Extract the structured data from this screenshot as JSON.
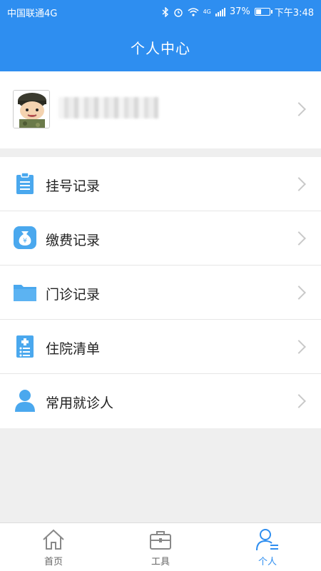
{
  "status": {
    "carrier": "中国联通4G",
    "network": "4G",
    "battery": "37%",
    "time": "下午3:48"
  },
  "header": {
    "title": "个人中心"
  },
  "menu": {
    "items": [
      {
        "label": "挂号记录"
      },
      {
        "label": "缴费记录"
      },
      {
        "label": "门诊记录"
      },
      {
        "label": "住院清单"
      },
      {
        "label": "常用就诊人"
      }
    ]
  },
  "tabs": [
    {
      "label": "首页"
    },
    {
      "label": "工具"
    },
    {
      "label": "个人"
    }
  ],
  "colors": {
    "primary": "#2e8ef0",
    "icon": "#4aa8ee",
    "background": "#efefef"
  }
}
